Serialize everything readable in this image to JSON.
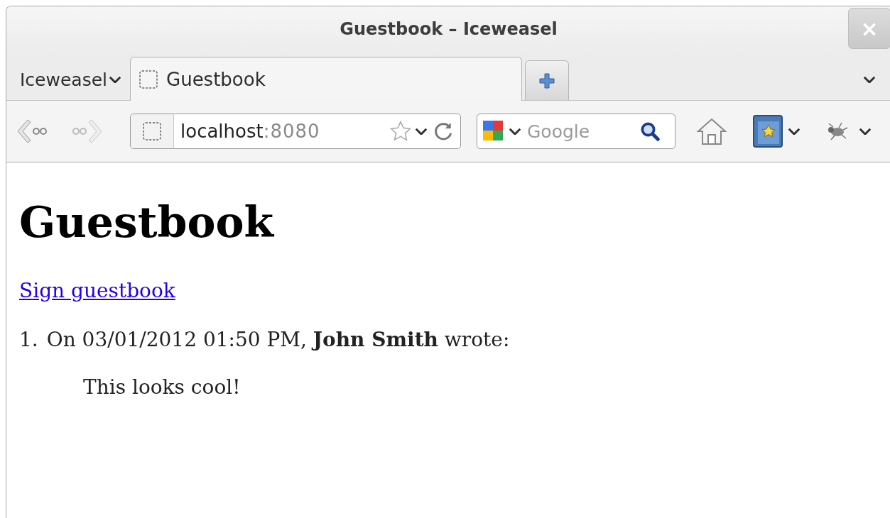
{
  "window": {
    "title": "Guestbook – Iceweasel",
    "close": "×"
  },
  "app_menu": {
    "label": "Iceweasel"
  },
  "tabs": [
    {
      "label": "Guestbook",
      "selected": true
    }
  ],
  "url_bar": {
    "host": "localhost",
    "port": ":8080"
  },
  "search": {
    "placeholder": "Google"
  },
  "page": {
    "heading": "Guestbook",
    "link": "Sign guestbook",
    "entries": [
      {
        "number": "1.",
        "header": "On 03/01/2012 01:50 PM, **John Smith** wrote:",
        "message": "This looks cool!"
      }
    ]
  }
}
